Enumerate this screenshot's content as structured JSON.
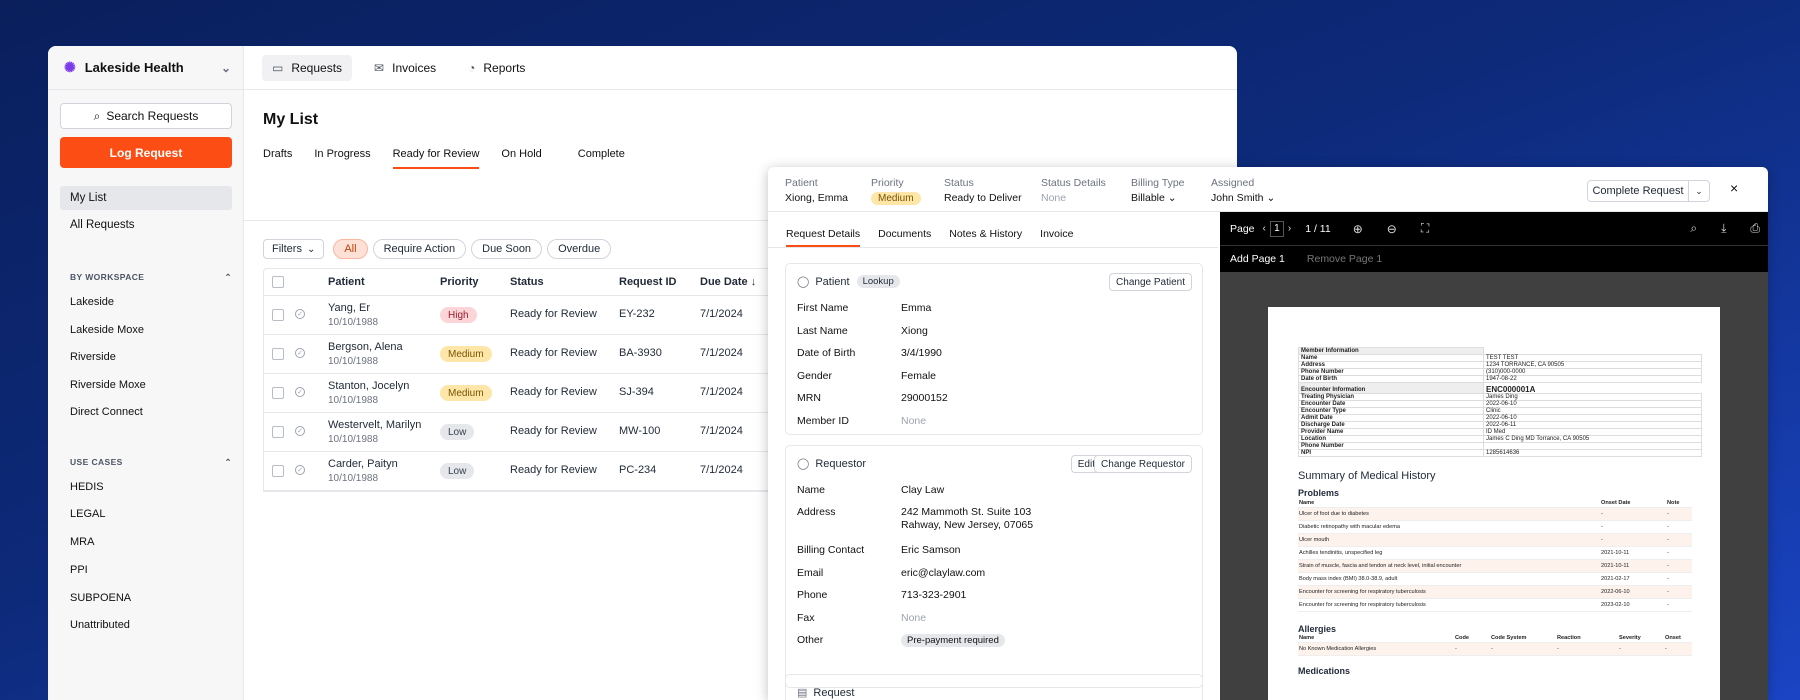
{
  "workspace": {
    "name": "Lakeside Health"
  },
  "sidebar": {
    "search_label": "Search Requests",
    "log_label": "Log Request",
    "nav": [
      {
        "label": "My List",
        "selected": true
      },
      {
        "label": "All Requests",
        "selected": false
      }
    ],
    "by_workspace": {
      "title": "BY WORKSPACE",
      "items": [
        "Lakeside",
        "Lakeside Moxe",
        "Riverside",
        "Riverside Moxe",
        "Direct Connect"
      ]
    },
    "use_cases": {
      "title": "USE CASES",
      "items": [
        "HEDIS",
        "LEGAL",
        "MRA",
        "PPI",
        "SUBPOENA",
        "Unattributed"
      ]
    }
  },
  "topnav": [
    {
      "label": "Requests",
      "icon": "inbox-icon",
      "selected": true
    },
    {
      "label": "Invoices",
      "icon": "envelope-icon",
      "selected": false
    },
    {
      "label": "Reports",
      "icon": "chart-icon",
      "selected": false
    }
  ],
  "main": {
    "title": "My List",
    "tabs": [
      {
        "label": "Drafts"
      },
      {
        "label": "In Progress"
      },
      {
        "label": "Ready for Review",
        "selected": true
      },
      {
        "label": "On Hold"
      },
      {
        "label": "Complete"
      }
    ],
    "filter_label": "Filters",
    "chips": [
      {
        "label": "All",
        "selected": true
      },
      {
        "label": "Require Action"
      },
      {
        "label": "Due Soon"
      },
      {
        "label": "Overdue"
      }
    ],
    "columns": {
      "patient": "Patient",
      "priority": "Priority",
      "status": "Status",
      "request_id": "Request ID",
      "due_date": "Due Date"
    },
    "rows": [
      {
        "name": "Yang, Er",
        "dob": "10/10/1988",
        "priority": "High",
        "status": "Ready for Review",
        "id": "EY-232",
        "due": "7/1/2024"
      },
      {
        "name": "Bergson, Alena",
        "dob": "10/10/1988",
        "priority": "Medium",
        "status": "Ready for Review",
        "id": "BA-3930",
        "due": "7/1/2024"
      },
      {
        "name": "Stanton, Jocelyn",
        "dob": "10/10/1988",
        "priority": "Medium",
        "status": "Ready for Review",
        "id": "SJ-394",
        "due": "7/1/2024"
      },
      {
        "name": "Westervelt, Marilyn",
        "dob": "10/10/1988",
        "priority": "Low",
        "status": "Ready for Review",
        "id": "MW-100",
        "due": "7/1/2024"
      },
      {
        "name": "Carder, Paityn",
        "dob": "10/10/1988",
        "priority": "Low",
        "status": "Ready for Review",
        "id": "PC-234",
        "due": "7/1/2024"
      }
    ]
  },
  "panel": {
    "header": {
      "patient": {
        "label": "Patient",
        "value": "Xiong, Emma"
      },
      "priority": {
        "label": "Priority",
        "value": "Medium"
      },
      "status": {
        "label": "Status",
        "value": "Ready to Deliver"
      },
      "status_details": {
        "label": "Status Details",
        "value": "None"
      },
      "billing_type": {
        "label": "Billing Type",
        "value": "Billable"
      },
      "assigned": {
        "label": "Assigned",
        "value": "John Smith"
      }
    },
    "complete_label": "Complete Request",
    "tabs": [
      {
        "label": "Request Details",
        "selected": true
      },
      {
        "label": "Documents"
      },
      {
        "label": "Notes & History"
      },
      {
        "label": "Invoice"
      }
    ],
    "patient_card": {
      "title": "Patient",
      "tag": "Lookup",
      "change_label": "Change Patient",
      "fields": [
        {
          "label": "First Name",
          "value": "Emma"
        },
        {
          "label": "Last Name",
          "value": "Xiong"
        },
        {
          "label": "Date of Birth",
          "value": "3/4/1990"
        },
        {
          "label": "Gender",
          "value": "Female"
        },
        {
          "label": "MRN",
          "value": "29000152"
        },
        {
          "label": "Member ID",
          "value": "None",
          "empty": true
        }
      ]
    },
    "requestor_card": {
      "title": "Requestor",
      "edit_label": "Edit",
      "change_label": "Change Requestor",
      "name": {
        "label": "Name",
        "value": "Clay Law"
      },
      "address": {
        "label": "Address",
        "line1": "242 Mammoth St. Suite 103",
        "line2": "Rahway, New Jersey, 07065"
      },
      "billing": {
        "label": "Billing Contact",
        "value": "Eric Samson"
      },
      "email": {
        "label": "Email",
        "value": "eric@claylaw.com"
      },
      "phone": {
        "label": "Phone",
        "value": "713-323-2901"
      },
      "fax": {
        "label": "Fax",
        "value": "None"
      },
      "other": {
        "label": "Other",
        "value": "Pre-payment required"
      }
    },
    "request_card": {
      "title": "Request"
    }
  },
  "viewer": {
    "page_label": "Page",
    "page_value": "1",
    "page_count": "1 / 11",
    "add_page": "Add Page 1",
    "remove_page": "Remove Page 1",
    "doc": {
      "member_title": "Member Information",
      "member": [
        {
          "k": "Name",
          "v": "TEST TEST"
        },
        {
          "k": "Address",
          "v": "1234 TORRANCE, CA 90505"
        },
        {
          "k": "Phone Number",
          "v": "(310)000-0000"
        },
        {
          "k": "Date of Birth",
          "v": "1947-08-22"
        }
      ],
      "encounter_title": "Encounter Information",
      "encounter_id": "ENC000001A",
      "encounter": [
        {
          "k": "Treating Physician",
          "v": "James Ding"
        },
        {
          "k": "Encounter Date",
          "v": "2022-06-10"
        },
        {
          "k": "Encounter Type",
          "v": "Clinic"
        },
        {
          "k": "Admit Date",
          "v": "2022-06-10"
        },
        {
          "k": "Discharge Date",
          "v": "2022-06-11"
        },
        {
          "k": "Provider Name",
          "v": "ID Med"
        },
        {
          "k": "Location",
          "v": "James C Ding MD Torrance, CA 90505"
        },
        {
          "k": "Phone Number",
          "v": ""
        },
        {
          "k": "NPI",
          "v": "1285614636"
        }
      ],
      "summary_title": "Summary of Medical History",
      "problems_title": "Problems",
      "problems_cols": {
        "name": "Name",
        "onset": "Onset Date",
        "note": "Note"
      },
      "problems": [
        {
          "name": "Ulcer of foot due to diabetes",
          "onset": "-",
          "note": "-"
        },
        {
          "name": "Diabetic retinopathy with macular edema",
          "onset": "-",
          "note": "-"
        },
        {
          "name": "Ulcer mouth",
          "onset": "-",
          "note": "-"
        },
        {
          "name": "Achilles tendinitis, unspecified leg",
          "onset": "2021-10-11",
          "note": "-"
        },
        {
          "name": "Strain of muscle, fascia and tendon at neck level, initial encounter",
          "onset": "2021-10-11",
          "note": "-"
        },
        {
          "name": "Body mass index (BMI) 38.0-38.9, adult",
          "onset": "2021-02-17",
          "note": "-"
        },
        {
          "name": "Encounter for screening for respiratory tuberculosis",
          "onset": "2022-06-10",
          "note": "-"
        },
        {
          "name": "Encounter for screening for respiratory tuberculosis",
          "onset": "2023-02-10",
          "note": "-"
        }
      ],
      "allergies_title": "Allergies",
      "allergy_cols": {
        "name": "Name",
        "code": "Code",
        "code_system": "Code System",
        "reaction": "Reaction",
        "severity": "Severity",
        "onset": "Onset"
      },
      "allergy": {
        "name": "No Known Medication Allergies",
        "code": "-",
        "code_system": "-",
        "reaction": "-",
        "severity": "-",
        "onset": "-"
      },
      "medications_title": "Medications"
    }
  }
}
